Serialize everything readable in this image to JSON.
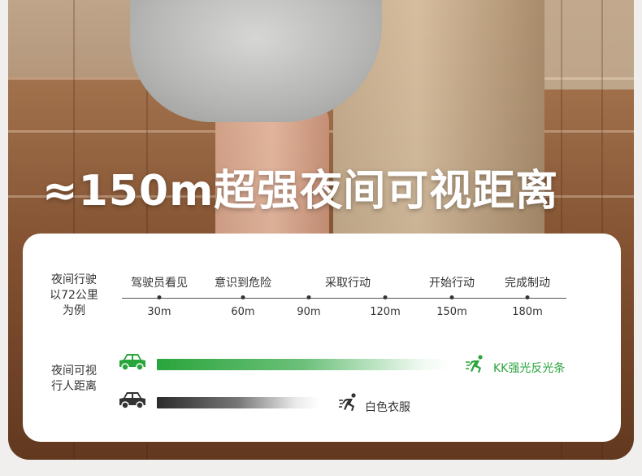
{
  "headline": "≈150m超强夜间可视距离",
  "card": {
    "row1_label": [
      "夜间行驶",
      "以72公里",
      "为例"
    ],
    "row2_label": [
      "夜间可视",
      "行人距离"
    ],
    "stages": [
      "驾驶员看见",
      "意识到危险",
      "采取行动",
      "开始行动",
      "完成制动"
    ],
    "distances": [
      "30m",
      "60m",
      "90m",
      "120m",
      "150m",
      "180m"
    ],
    "reflective": {
      "label": "KK强光反光条",
      "color": "#2aa53c",
      "icon": "running-person-icon"
    },
    "white_clothes": {
      "label": "白色衣服",
      "color": "#333333",
      "icon": "running-person-icon"
    },
    "car_icon": "car-icon"
  }
}
